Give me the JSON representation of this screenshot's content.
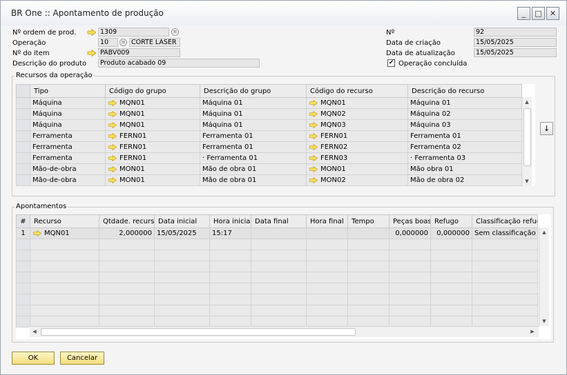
{
  "window": {
    "title": "BR One :: Apontamento de produção",
    "minimize_glyph": "_",
    "maximize_glyph": "□",
    "close_glyph": "✕"
  },
  "header": {
    "ordem_label": "Nº ordem de prod.",
    "ordem_value": "1309",
    "operacao_label": "Operação",
    "operacao_value": "10",
    "operacao_desc": "CORTE LASER",
    "item_label": "Nº do item",
    "item_value": "PABV009",
    "descricao_label": "Descrição do produto",
    "descricao_value": "Produto acabado 09",
    "numero_label": "Nº",
    "numero_value": "92",
    "data_criacao_label": "Data de criação",
    "data_criacao_value": "15/05/2025",
    "data_atualizacao_label": "Data de atualização",
    "data_atualizacao_value": "15/05/2025",
    "operacao_concluida_label": "Operação concluída",
    "operacao_concluida_checked": true,
    "info_glyph": "≡"
  },
  "recursos": {
    "title": "Recursos da operação",
    "columns": [
      "Tipo",
      "Código do grupo",
      "Descrição do grupo",
      "Código do recurso",
      "Descrição do recurso"
    ],
    "rows": [
      {
        "tipo": "Máquina",
        "cod_grupo": "MQN01",
        "desc_grupo": "Máquina 01",
        "cod_recurso": "MQN01",
        "desc_recurso": "Máquina 01"
      },
      {
        "tipo": "Máquina",
        "cod_grupo": "MQN01",
        "desc_grupo": "Máquina 01",
        "cod_recurso": "MQN02",
        "desc_recurso": "Máquina 02"
      },
      {
        "tipo": "Máquina",
        "cod_grupo": "MQN01",
        "desc_grupo": "Máquina 01",
        "cod_recurso": "MQN03",
        "desc_recurso": "Máquina 03"
      },
      {
        "tipo": "Ferramenta",
        "cod_grupo": "FERN01",
        "desc_grupo": "Ferramenta 01",
        "cod_recurso": "FERN01",
        "desc_recurso": "Ferramenta 01"
      },
      {
        "tipo": "Ferramenta",
        "cod_grupo": "FERN01",
        "desc_grupo": "Ferramenta 01",
        "cod_recurso": "FERN02",
        "desc_recurso": "Ferramenta 02"
      },
      {
        "tipo": "Ferramenta",
        "cod_grupo": "FERN01",
        "desc_grupo": "·      Ferramenta 01",
        "cod_recurso": "FERN03",
        "desc_recurso": "·      Ferramenta 03"
      },
      {
        "tipo": "Mão-de-obra",
        "cod_grupo": "MON01",
        "desc_grupo": "Mão de obra 01",
        "cod_recurso": "MON01",
        "desc_recurso": "Mão obra 01"
      },
      {
        "tipo": "Mão-de-obra",
        "cod_grupo": "MON01",
        "desc_grupo": "Mão de obra 01",
        "cod_recurso": "MON02",
        "desc_recurso": "Mão de obra 02"
      }
    ],
    "side_button_glyph": "↓"
  },
  "apontamentos": {
    "title": "Apontamentos",
    "columns": [
      "#",
      "Recurso",
      "Qtdade. recurso",
      "Data inicial",
      "Hora inicial",
      "Data final",
      "Hora final",
      "Tempo",
      "Peças boas",
      "Refugo",
      "Classificação refugo"
    ],
    "rows": [
      {
        "n": "1",
        "recurso": "MQN01",
        "qtd": "2,000000",
        "data_inicial": "15/05/2025",
        "hora_inicial": "15:17",
        "data_final": "",
        "hora_final": "",
        "tempo": "",
        "pecas_boas": "0,000000",
        "refugo": "0,000000",
        "classificacao": "Sem classificação"
      }
    ],
    "empty_rows": 8
  },
  "buttons": {
    "ok_label": "OK",
    "cancel_label": "Cancelar"
  }
}
